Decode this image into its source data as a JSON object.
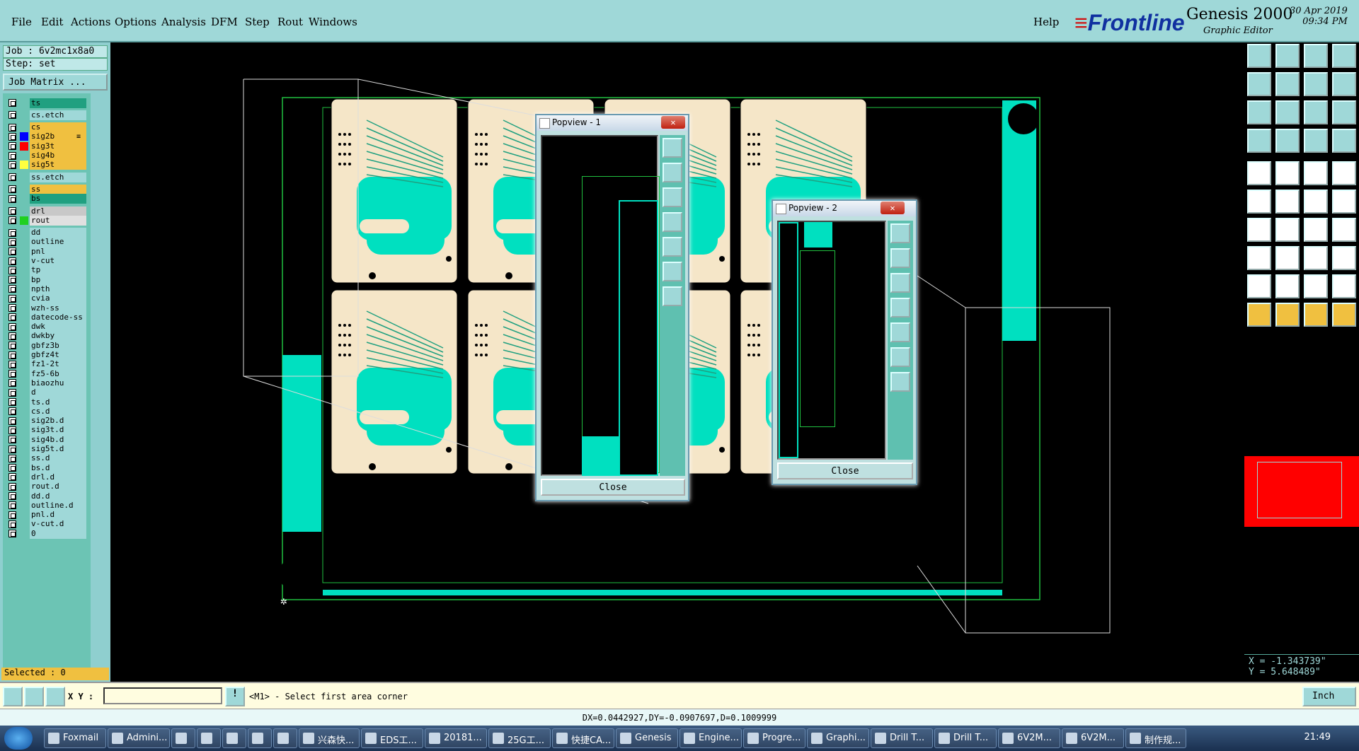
{
  "menu": {
    "file": "File",
    "edit": "Edit",
    "actions": "Actions",
    "options": "Options",
    "analysis": "Analysis",
    "dfm": "DFM",
    "step": "Step",
    "rout": "Rout",
    "windows": "Windows",
    "help": "Help"
  },
  "brand": {
    "logo_main": "Frontline",
    "app": "Genesis 2000",
    "subtitle": "Graphic Editor",
    "date": "30 Apr 2019",
    "time": "09:34 PM"
  },
  "job": {
    "job_label": "Job : 6v2mc1x8a0",
    "step_label": "Step: set",
    "matrix_button": "Job Matrix ..."
  },
  "layers": [
    {
      "name": "ts",
      "color": "#20a080"
    },
    {
      "name": "cs.etch",
      "color": "#9fd8d8"
    },
    {
      "name": "cs",
      "color": "#f0c040"
    },
    {
      "name": "sig2b",
      "color": "#f0c040",
      "swatch": "#0000ff",
      "mark": "≡"
    },
    {
      "name": "sig3t",
      "color": "#f0c040",
      "swatch": "#ff0000"
    },
    {
      "name": "sig4b",
      "color": "#f0c040"
    },
    {
      "name": "sig5t",
      "color": "#f0c040",
      "swatch": "#ffff40"
    },
    {
      "name": "ss.etch",
      "color": "#9fd8d8"
    },
    {
      "name": "ss",
      "color": "#f0c040"
    },
    {
      "name": "bs",
      "color": "#20a080"
    },
    {
      "name": "drl",
      "color": "#c8c8c8"
    },
    {
      "name": "rout",
      "color": "#e0e0e0",
      "swatch": "#20d020"
    },
    {
      "name": "dd",
      "color": "#9fd8d8"
    },
    {
      "name": "outline",
      "color": "#9fd8d8"
    },
    {
      "name": "pnl",
      "color": "#9fd8d8"
    },
    {
      "name": "v-cut",
      "color": "#9fd8d8"
    },
    {
      "name": "tp",
      "color": "#9fd8d8"
    },
    {
      "name": "bp",
      "color": "#9fd8d8"
    },
    {
      "name": "npth",
      "color": "#9fd8d8"
    },
    {
      "name": "cvia",
      "color": "#9fd8d8"
    },
    {
      "name": "wzh-ss",
      "color": "#9fd8d8"
    },
    {
      "name": "datecode-ss",
      "color": "#9fd8d8"
    },
    {
      "name": "dwk",
      "color": "#9fd8d8"
    },
    {
      "name": "dwkby",
      "color": "#9fd8d8"
    },
    {
      "name": "gbfz3b",
      "color": "#9fd8d8"
    },
    {
      "name": "gbfz4t",
      "color": "#9fd8d8"
    },
    {
      "name": "fz1-2t",
      "color": "#9fd8d8"
    },
    {
      "name": "fz5-6b",
      "color": "#9fd8d8"
    },
    {
      "name": "biaozhu",
      "color": "#9fd8d8"
    },
    {
      "name": "d",
      "color": "#9fd8d8"
    },
    {
      "name": "ts.d",
      "color": "#9fd8d8"
    },
    {
      "name": "cs.d",
      "color": "#9fd8d8"
    },
    {
      "name": "sig2b.d",
      "color": "#9fd8d8"
    },
    {
      "name": "sig3t.d",
      "color": "#9fd8d8"
    },
    {
      "name": "sig4b.d",
      "color": "#9fd8d8"
    },
    {
      "name": "sig5t.d",
      "color": "#9fd8d8"
    },
    {
      "name": "ss.d",
      "color": "#9fd8d8"
    },
    {
      "name": "bs.d",
      "color": "#9fd8d8"
    },
    {
      "name": "drl.d",
      "color": "#9fd8d8"
    },
    {
      "name": "rout.d",
      "color": "#9fd8d8"
    },
    {
      "name": "dd.d",
      "color": "#9fd8d8"
    },
    {
      "name": "outline.d",
      "color": "#9fd8d8"
    },
    {
      "name": "pnl.d",
      "color": "#9fd8d8"
    },
    {
      "name": "v-cut.d",
      "color": "#9fd8d8"
    },
    {
      "name": "0",
      "color": "#9fd8d8"
    }
  ],
  "selected": "Selected : 0",
  "popview1": {
    "title": "Popview - 1",
    "close": "Close"
  },
  "popview2": {
    "title": "Popview - 2",
    "close": "Close"
  },
  "coords": {
    "x": "X = -1.343739\"",
    "y": "Y = 5.648489\""
  },
  "status": {
    "xy_label": "X Y :",
    "xy_value": "",
    "prompt": "<M1> - Select first area corner",
    "units": "Inch",
    "info": "DX=0.0442927,DY=-0.0907697,D=0.1009999"
  },
  "taskbar": {
    "items": [
      "Foxmail",
      "Admini...",
      "",
      "",
      "",
      "",
      "",
      "兴森快...",
      "EDS工...",
      "20181...",
      "25G工...",
      "快捷CA...",
      "Genesis",
      "Engine...",
      "Progre...",
      "Graphi...",
      "Drill T...",
      "Drill T...",
      "6V2M...",
      "6V2M...",
      "制作规..."
    ],
    "time": "21:49"
  }
}
